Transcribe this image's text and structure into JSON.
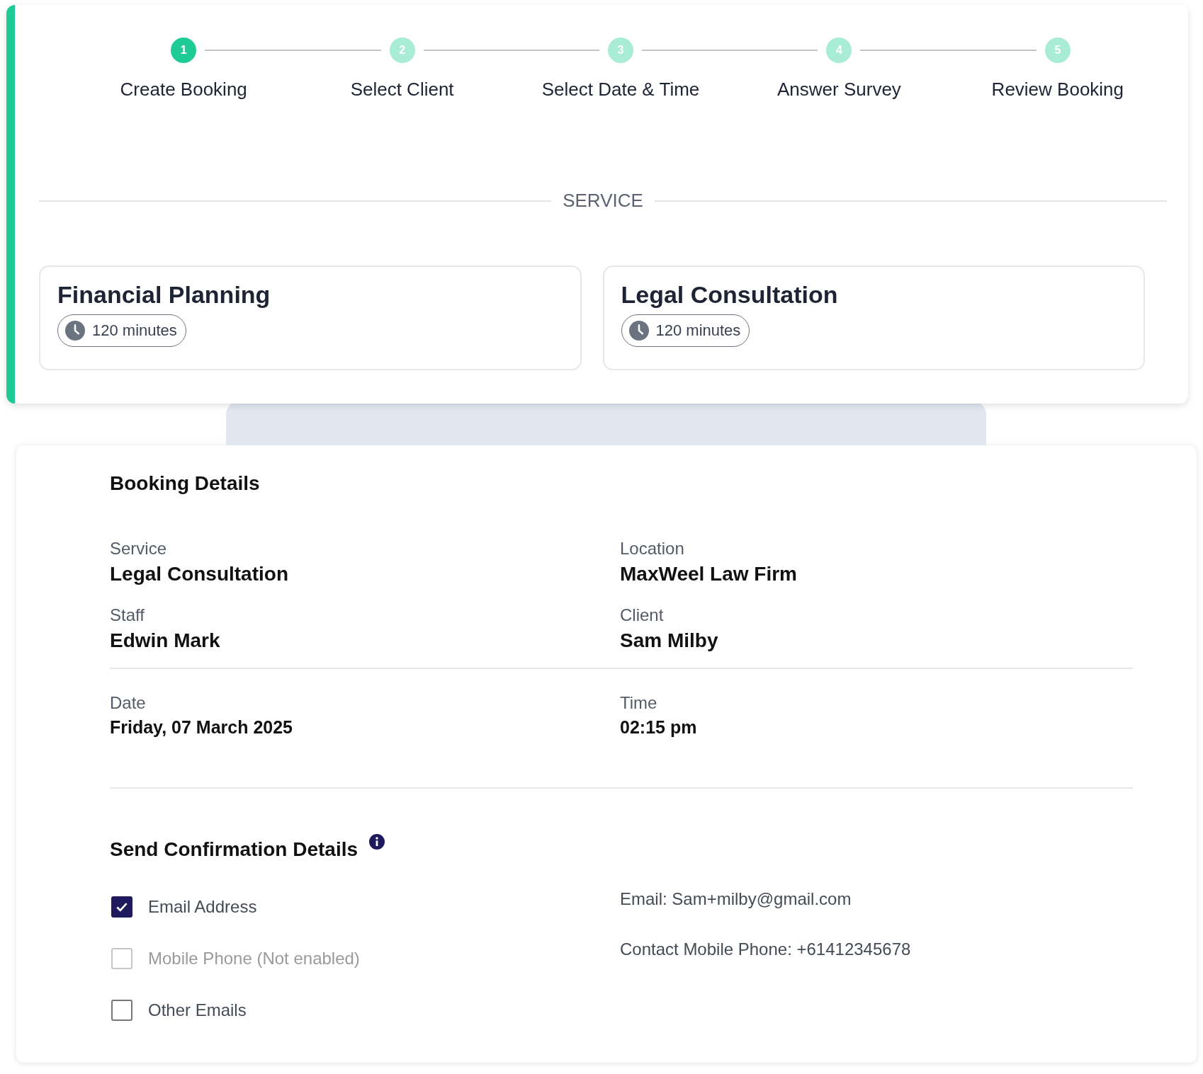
{
  "steps": [
    {
      "number": "1",
      "label": "Create Booking",
      "selected": true
    },
    {
      "number": "2",
      "label": "Select Client",
      "selected": false
    },
    {
      "number": "3",
      "label": "Select Date & Time",
      "selected": false
    },
    {
      "number": "4",
      "label": "Answer Survey",
      "selected": false
    },
    {
      "number": "5",
      "label": "Review Booking",
      "selected": false
    }
  ],
  "service_section": {
    "heading": "SERVICE",
    "services": [
      {
        "name": "Financial Planning",
        "duration": "120 minutes"
      },
      {
        "name": "Legal Consultation",
        "duration": "120 minutes"
      }
    ]
  },
  "booking_details": {
    "title": "Booking Details",
    "groups": [
      [
        {
          "label": "Service",
          "value": "Legal Consultation"
        },
        {
          "label": "Location",
          "value": "MaxWeel Law Firm"
        },
        {
          "label": "Staff",
          "value": "Edwin Mark"
        },
        {
          "label": "Client",
          "value": "Sam Milby"
        }
      ],
      [
        {
          "label": "Date",
          "value": "Friday, 07 March 2025"
        },
        {
          "label": "Time",
          "value": "02:15 pm"
        }
      ]
    ]
  },
  "confirmation": {
    "title": "Send Confirmation Details",
    "options": [
      {
        "label": "Email Address",
        "checked": true,
        "disabled": false
      },
      {
        "label": "Mobile Phone (Not enabled)",
        "checked": false,
        "disabled": true
      },
      {
        "label": "Other Emails",
        "checked": false,
        "disabled": false
      }
    ],
    "contacts": [
      "Email: Sam+milby@gmail.com",
      "Contact Mobile Phone: +61412345678"
    ]
  }
}
